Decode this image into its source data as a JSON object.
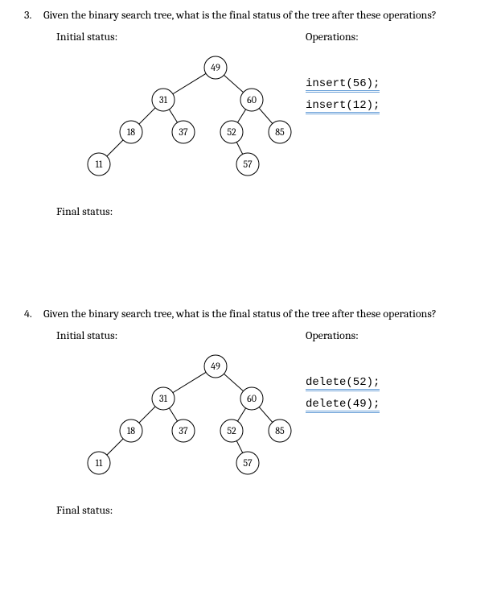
{
  "questions": [
    {
      "number": "3.",
      "prompt": "Given the binary search tree, what is the final status of the tree after these operations?",
      "initial_label": "Initial status:",
      "operations_label": "Operations:",
      "final_label": "Final status:",
      "operations": [
        "insert(56);",
        "insert(12);"
      ],
      "tree": {
        "root": {
          "value": "49"
        },
        "left": {
          "value": "31",
          "left": {
            "value": "18",
            "left": {
              "value": "11"
            }
          },
          "right": {
            "value": "37"
          }
        },
        "right": {
          "value": "60",
          "left": {
            "value": "52",
            "right": {
              "value": "57"
            }
          },
          "right": {
            "value": "85"
          }
        }
      }
    },
    {
      "number": "4.",
      "prompt": "Given the binary search tree, what is the final status of the tree after these operations?",
      "initial_label": "Initial status:",
      "operations_label": "Operations:",
      "final_label": "Final status:",
      "operations": [
        "delete(52);",
        "delete(49);"
      ],
      "tree": {
        "root": {
          "value": "49"
        },
        "left": {
          "value": "31",
          "left": {
            "value": "18",
            "left": {
              "value": "11"
            }
          },
          "right": {
            "value": "37"
          }
        },
        "right": {
          "value": "60",
          "left": {
            "value": "52",
            "right": {
              "value": "57"
            }
          },
          "right": {
            "value": "85"
          }
        }
      }
    }
  ]
}
